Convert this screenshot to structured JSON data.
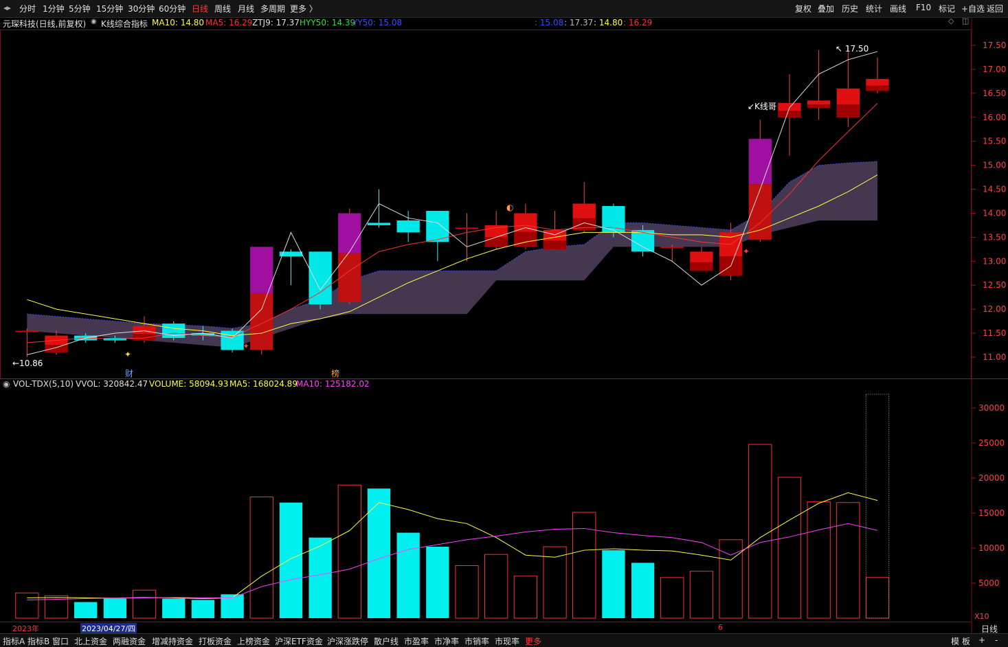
{
  "topbar": {
    "nav_icon": "chevron-left-right-icon",
    "periods": [
      "分时",
      "1分钟",
      "5分钟",
      "15分钟",
      "30分钟",
      "60分钟",
      "日线",
      "周线",
      "月线",
      "多周期",
      "更多 〉"
    ],
    "active_period": "日线",
    "right_buttons": [
      "复权",
      "叠加",
      "历史",
      "统计",
      "画线",
      "F10",
      "标记",
      "+自选",
      "返回"
    ]
  },
  "info": {
    "stock": "元琛科技(日线,前复权)",
    "indicator": "K线综合指标",
    "ma10": "MA10: 14.80",
    "ma5": "MA5: 16.29",
    "ztj9": "ZTJ9: 17.37",
    "hyy50": "HYY50: 14.39",
    "yy50": "YY50: 15.08",
    "cursor_vals": [
      ": 15.08",
      ": 17.37",
      ": 14.80",
      ": 16.29"
    ]
  },
  "price_axis": [
    "17.50",
    "17.00",
    "16.50",
    "16.00",
    "15.50",
    "15.00",
    "14.50",
    "14.00",
    "13.50",
    "13.00",
    "12.50",
    "12.00",
    "11.50",
    "11.00"
  ],
  "annotations": {
    "high": "17.50",
    "low": "10.86",
    "kline_label": "K线哥",
    "cai": "财",
    "bang": "榜"
  },
  "vol": {
    "title": "VOL-TDX(5,10)",
    "vvol": "VVOL: 320842.47",
    "volume": "VOLUME: 58094.93",
    "ma5": "MA5: 168024.89",
    "ma10": "MA10: 125182.02",
    "axis": [
      "30000",
      "25000",
      "20000",
      "15000",
      "10000",
      "5000"
    ],
    "unit": "X10"
  },
  "dates": {
    "year": "2023年",
    "cursor": "2023/04/27/四",
    "mark6": "6",
    "period_label": "日线"
  },
  "bottom_tabs": [
    "指标A",
    "指标B",
    "窗口",
    "北上资金",
    "两融资金",
    "增减持资金",
    "打板资金",
    "上榜资金",
    "沪深ETF资金",
    "沪深涨跌停",
    "散户线",
    "市盈率",
    "市净率",
    "市销率",
    "市现率",
    "更多"
  ],
  "bottom_right": [
    "模",
    "板",
    "+",
    "-"
  ],
  "colors": {
    "up": "#ff2020",
    "down": "#00f0f0",
    "ma5": "#ff3030",
    "ma10": "#ffff40",
    "cloud": "#4a3a55",
    "accent": "#ff3b3b"
  },
  "chart_data": {
    "type": "candlestick",
    "candles": [
      {
        "o": 11.55,
        "c": 11.55,
        "h": 11.6,
        "l": 11.0
      },
      {
        "o": 11.1,
        "c": 11.45,
        "h": 11.55,
        "l": 11.05
      },
      {
        "o": 11.45,
        "c": 11.35,
        "h": 11.5,
        "l": 11.3
      },
      {
        "o": 11.4,
        "c": 11.35,
        "h": 11.45,
        "l": 11.3
      },
      {
        "o": 11.35,
        "c": 11.65,
        "h": 11.85,
        "l": 11.3
      },
      {
        "o": 11.7,
        "c": 11.4,
        "h": 11.75,
        "l": 11.35
      },
      {
        "o": 11.5,
        "c": 11.45,
        "h": 11.65,
        "l": 11.35
      },
      {
        "o": 11.55,
        "c": 11.15,
        "h": 11.6,
        "l": 11.1
      },
      {
        "o": 11.15,
        "c": 13.3,
        "h": 13.3,
        "l": 11.05
      },
      {
        "o": 13.2,
        "c": 13.1,
        "h": 13.25,
        "l": 12.5
      },
      {
        "o": 13.2,
        "c": 12.1,
        "h": 13.2,
        "l": 12.0
      },
      {
        "o": 12.15,
        "c": 14.0,
        "h": 14.1,
        "l": 12.1
      },
      {
        "o": 13.8,
        "c": 13.75,
        "h": 14.5,
        "l": 13.7
      },
      {
        "o": 13.85,
        "c": 13.6,
        "h": 14.05,
        "l": 13.4
      },
      {
        "o": 14.05,
        "c": 13.4,
        "h": 14.05,
        "l": 13.0
      },
      {
        "o": 13.7,
        "c": 13.7,
        "h": 14.0,
        "l": 13.0
      },
      {
        "o": 13.3,
        "c": 13.75,
        "h": 14.05,
        "l": 13.25
      },
      {
        "o": 13.3,
        "c": 14.0,
        "h": 14.2,
        "l": 13.25
      },
      {
        "o": 13.25,
        "c": 13.65,
        "h": 14.05,
        "l": 13.25
      },
      {
        "o": 13.65,
        "c": 14.2,
        "h": 14.65,
        "l": 13.6
      },
      {
        "o": 14.15,
        "c": 13.6,
        "h": 14.2,
        "l": 13.5
      },
      {
        "o": 13.65,
        "c": 13.2,
        "h": 13.75,
        "l": 13.1
      },
      {
        "o": 13.3,
        "c": 13.3,
        "h": 13.35,
        "l": 13.0
      },
      {
        "o": 12.8,
        "c": 13.2,
        "h": 13.3,
        "l": 12.8
      },
      {
        "o": 12.7,
        "c": 13.6,
        "h": 13.8,
        "l": 12.6
      },
      {
        "o": 13.45,
        "c": 15.55,
        "h": 15.95,
        "l": 13.4
      },
      {
        "o": 16.0,
        "c": 16.3,
        "h": 16.9,
        "l": 15.2
      },
      {
        "o": 16.2,
        "c": 16.35,
        "h": 17.4,
        "l": 15.95
      },
      {
        "o": 16.0,
        "c": 16.6,
        "h": 17.5,
        "l": 15.8
      },
      {
        "o": 16.55,
        "c": 16.8,
        "h": 17.25,
        "l": 16.5
      }
    ],
    "ma5": [
      11.3,
      11.35,
      11.4,
      11.38,
      11.4,
      11.5,
      11.45,
      11.42,
      11.7,
      12.0,
      12.35,
      12.8,
      13.2,
      13.35,
      13.45,
      13.6,
      13.7,
      13.75,
      13.65,
      13.7,
      13.7,
      13.6,
      13.5,
      13.4,
      13.35,
      13.8,
      14.4,
      15.1,
      15.7,
      16.29
    ],
    "ma10": [
      12.2,
      12.0,
      11.9,
      11.8,
      11.7,
      11.6,
      11.55,
      11.45,
      11.5,
      11.7,
      11.8,
      11.95,
      12.25,
      12.55,
      12.8,
      13.05,
      13.25,
      13.4,
      13.5,
      13.6,
      13.6,
      13.6,
      13.55,
      13.55,
      13.5,
      13.65,
      13.9,
      14.15,
      14.45,
      14.8
    ],
    "ztj9": [
      11.05,
      11.2,
      11.4,
      11.5,
      11.55,
      11.45,
      11.5,
      11.4,
      12.0,
      13.6,
      12.4,
      13.2,
      14.2,
      13.9,
      13.8,
      13.3,
      13.5,
      13.7,
      13.55,
      13.8,
      13.65,
      13.3,
      13.0,
      12.5,
      12.9,
      14.5,
      16.2,
      16.9,
      17.2,
      17.37
    ],
    "volume": [
      3600,
      3200,
      2300,
      2800,
      4000,
      2800,
      2600,
      3400,
      17300,
      16500,
      11500,
      19000,
      18500,
      12200,
      10200,
      7500,
      9100,
      6000,
      10200,
      15100,
      9700,
      7900,
      5800,
      6700,
      11200,
      24800,
      20100,
      16600,
      16500,
      5809
    ],
    "vol_ma5": [
      2900,
      2950,
      2900,
      2850,
      2950,
      2900,
      2800,
      2900,
      6000,
      8500,
      10300,
      12500,
      16500,
      15500,
      14200,
      13500,
      11500,
      9000,
      8700,
      9700,
      9900,
      9700,
      9600,
      9000,
      8300,
      11500,
      14000,
      16400,
      17900,
      16802
    ],
    "vol_ma10": [
      2600,
      2700,
      2800,
      2850,
      2900,
      2950,
      2900,
      2900,
      4500,
      5500,
      6200,
      7000,
      8500,
      9800,
      10500,
      11200,
      11700,
      12300,
      12700,
      12800,
      12200,
      11800,
      11500,
      10800,
      9000,
      10800,
      11600,
      12600,
      13500,
      12518
    ]
  }
}
